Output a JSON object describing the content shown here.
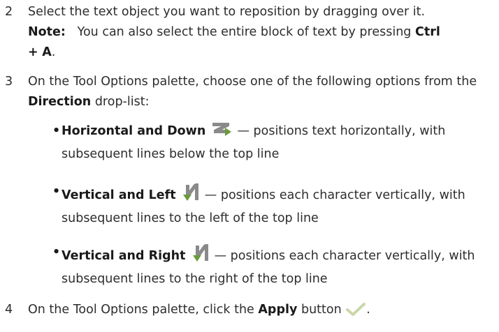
{
  "step2": {
    "number": "2",
    "text": "Select the text object you want to reposition by dragging over it.",
    "note_label": "Note:",
    "note_text_before": "You can also select the entire block of text by pressing",
    "note_key1": "Ctrl",
    "note_plus": "+",
    "note_key2": "A",
    "note_end": "."
  },
  "step3": {
    "number": "3",
    "text_before": "On the Tool Options palette, choose one of the following options from the",
    "direction_label": "Direction",
    "text_after": "drop-list:",
    "options": [
      {
        "bullet": "•",
        "label": "Horizontal and Down",
        "icon": "horizontal-down-icon",
        "desc": "— positions text horizontally, with subsequent lines below the top line"
      },
      {
        "bullet": "•",
        "label": "Vertical and Left",
        "icon": "vertical-left-icon",
        "desc": "— positions each character vertically, with subsequent lines to the left of the top line"
      },
      {
        "bullet": "•",
        "label": "Vertical and Right",
        "icon": "vertical-right-icon",
        "desc": "— positions each character vertically, with subsequent lines to the right of the top line"
      }
    ]
  },
  "step4": {
    "number": "4",
    "text_before": "On the Tool Options palette, click the",
    "apply_label": "Apply",
    "text_after": "button",
    "icon": "checkmark-icon",
    "end": "."
  },
  "colors": {
    "text": "#2d2d2d",
    "bold": "#1a1a1a",
    "icon_gray": "#8a8a8a",
    "icon_green": "#6a9a3a",
    "check": "#c9d7a8"
  }
}
